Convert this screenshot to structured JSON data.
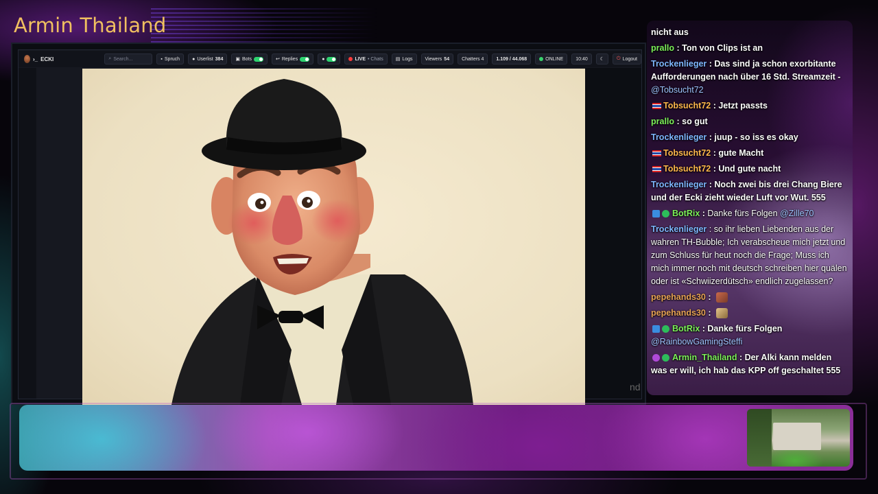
{
  "channel": {
    "title": "Armin Thailand"
  },
  "dashboard": {
    "brand": "ECKI",
    "prompt": "›_",
    "search_placeholder": "Search...",
    "spruch": "Spruch",
    "userlist": "Userlist",
    "userlist_count": "384",
    "bots": "Bots",
    "replies": "Replies",
    "live": "LIVE",
    "chats": "• Chats",
    "logs": "Logs",
    "viewers": "Viewers",
    "viewers_count": "54",
    "chatters": "Chatters 4",
    "ratio": "1.109 / 44.068",
    "online": "ONLINE",
    "time": "10:40",
    "logout": "Logout"
  },
  "video": {
    "corner_text": "nd"
  },
  "chat": {
    "messages": [
      {
        "user": "",
        "text": "nicht aus"
      },
      {
        "user": "prallo",
        "text": "Ton von Clips ist an"
      },
      {
        "user": "Trockenlieger",
        "text": "Das sind ja schon exorbitante Aufforderungen nach über 16 Std. Streamzeit - ",
        "mention": "@Tobsucht72"
      },
      {
        "user": "Tobsucht72",
        "text": "Jetzt passts"
      },
      {
        "user": "prallo",
        "text": "so gut"
      },
      {
        "user": "Trockenlieger",
        "text": "juup - so iss es okay"
      },
      {
        "user": "Tobsucht72",
        "text": "gute Macht"
      },
      {
        "user": "Tobsucht72",
        "text": "Und gute nacht"
      },
      {
        "user": "Trockenlieger",
        "text": "Noch zwei bis drei Chang Biere und der Ecki zieht wieder Luft vor Wut. 555"
      },
      {
        "user": "BotRix",
        "text": "Danke fürs Folgen ",
        "mention": "@Zille70"
      },
      {
        "user": "Trockenlieger",
        "text": "so ihr lieben Liebenden aus der wahren TH-Bubble; Ich verabscheue mich jetzt und zum Schluss für heut noch die Frage; Muss ich mich immer noch mit deutsch schreiben hier quälen oder ist «Schwiizerdütsch» endlich zugelassen?"
      },
      {
        "user": "pepehands30",
        "text": ""
      },
      {
        "user": "pepehands30",
        "text": ""
      },
      {
        "user": "BotRix",
        "text": "Danke fürs Folgen ",
        "mention": "@RainbowGamingSteffi"
      },
      {
        "user": "Armin_Thailand",
        "text": "Der Alki kann melden was er will, ich hab das KPP off geschaltet 555"
      }
    ]
  },
  "colors": {
    "title": "#f0c060",
    "accent": "#9b4fb0",
    "live": "#ff3b3b",
    "online": "#39d36d"
  },
  "icons": [
    "user-icon",
    "bot-icon",
    "reply-icon",
    "logs-icon",
    "moon-icon",
    "logout-icon",
    "thai-flag-icon",
    "verified-icon"
  ]
}
